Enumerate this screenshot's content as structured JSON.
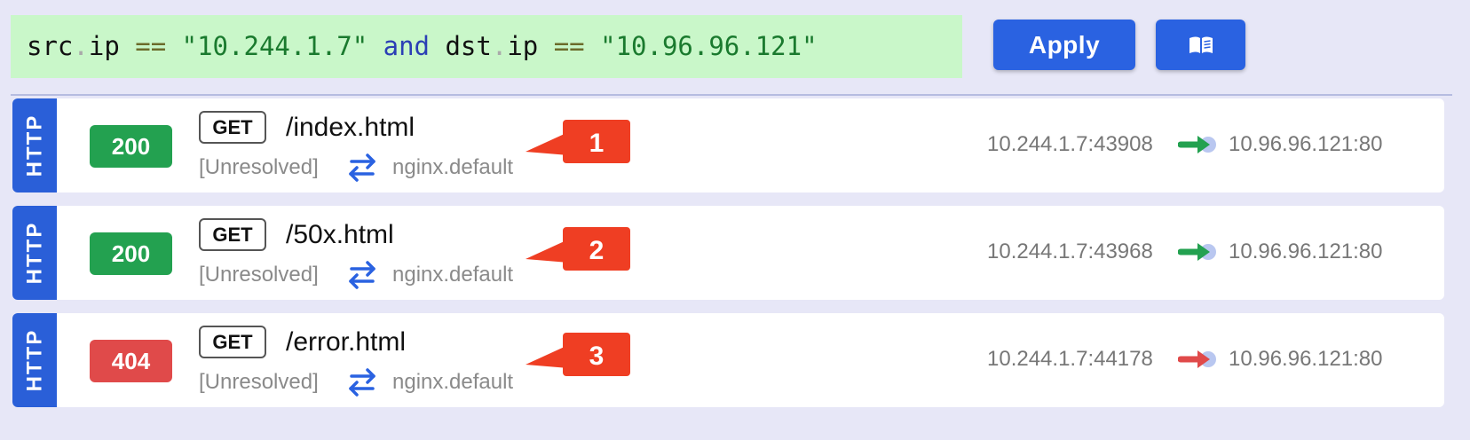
{
  "filter": {
    "query": "src.ip == \"10.244.1.7\" and dst.ip == \"10.96.96.121\"",
    "tokens": [
      {
        "t": "src",
        "c": ""
      },
      {
        "t": ".",
        "c": "tok-dot"
      },
      {
        "t": "ip ",
        "c": ""
      },
      {
        "t": "==",
        "c": "tok-op"
      },
      {
        "t": " ",
        "c": ""
      },
      {
        "t": "\"10.244.1.7\"",
        "c": "tok-str"
      },
      {
        "t": " ",
        "c": ""
      },
      {
        "t": "and",
        "c": "tok-kw"
      },
      {
        "t": " dst",
        "c": ""
      },
      {
        "t": ".",
        "c": "tok-dot"
      },
      {
        "t": "ip ",
        "c": ""
      },
      {
        "t": "==",
        "c": "tok-op"
      },
      {
        "t": " ",
        "c": ""
      },
      {
        "t": "\"10.96.96.121\"",
        "c": "tok-str"
      }
    ]
  },
  "toolbar": {
    "apply_label": "Apply",
    "docs_icon": "book-icon"
  },
  "entries": [
    {
      "protocol": "HTTP",
      "status": "200",
      "status_color": "#23a150",
      "method": "GET",
      "path": "/index.html",
      "source_name": "[Unresolved]",
      "service": "nginx.default",
      "src": "10.244.1.7:43908",
      "dst": "10.96.96.121:80",
      "flow_color": "#23a150",
      "callout": "1"
    },
    {
      "protocol": "HTTP",
      "status": "200",
      "status_color": "#23a150",
      "method": "GET",
      "path": "/50x.html",
      "source_name": "[Unresolved]",
      "service": "nginx.default",
      "src": "10.244.1.7:43968",
      "dst": "10.96.96.121:80",
      "flow_color": "#23a150",
      "callout": "2"
    },
    {
      "protocol": "HTTP",
      "status": "404",
      "status_color": "#e04a4a",
      "method": "GET",
      "path": "/error.html",
      "source_name": "[Unresolved]",
      "service": "nginx.default",
      "src": "10.244.1.7:44178",
      "dst": "10.96.96.121:80",
      "flow_color": "#e04a4a",
      "callout": "3"
    }
  ],
  "colors": {
    "accent": "#2a62e1",
    "callout": "#ef3e23",
    "filter_bg": "#c9f7c9",
    "page_bg": "#e7e7f7"
  }
}
